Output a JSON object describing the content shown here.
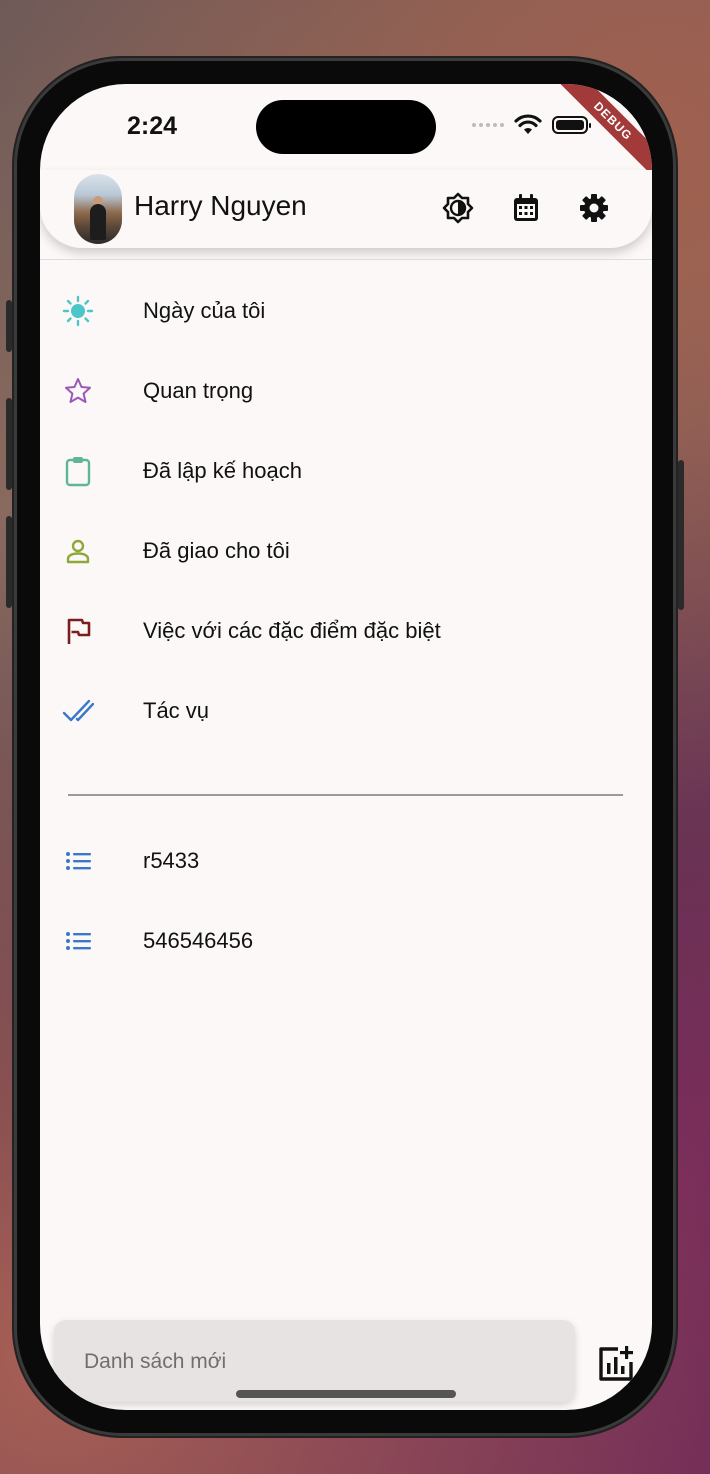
{
  "status_bar": {
    "time": "2:24",
    "debug_banner": "DEBUG"
  },
  "header": {
    "user_name": "Harry Nguyen",
    "icons": [
      "theme-toggle-icon",
      "calendar-icon",
      "settings-icon"
    ]
  },
  "menu": {
    "items": [
      {
        "label": "Ngày của tôi",
        "icon": "sun-icon",
        "color": "#4dc6c9"
      },
      {
        "label": "Quan trọng",
        "icon": "star-outline-icon",
        "color": "#9b59b6"
      },
      {
        "label": "Đã lập kế hoạch",
        "icon": "clipboard-icon",
        "color": "#5fb59a"
      },
      {
        "label": "Đã giao cho tôi",
        "icon": "person-icon",
        "color": "#8fa83a"
      },
      {
        "label": "Việc với các đặc điểm đặc biệt",
        "icon": "flag-icon",
        "color": "#7a1f1f"
      },
      {
        "label": "Tác vụ",
        "icon": "double-check-icon",
        "color": "#3a78c9"
      }
    ]
  },
  "lists": {
    "items": [
      {
        "label": "r5433",
        "icon": "list-icon",
        "color": "#3a78c9"
      },
      {
        "label": "546546456",
        "icon": "list-icon",
        "color": "#3a78c9"
      }
    ]
  },
  "footer": {
    "new_list_placeholder": "Danh sách mới",
    "add_list_icon": "add-chart-icon"
  }
}
